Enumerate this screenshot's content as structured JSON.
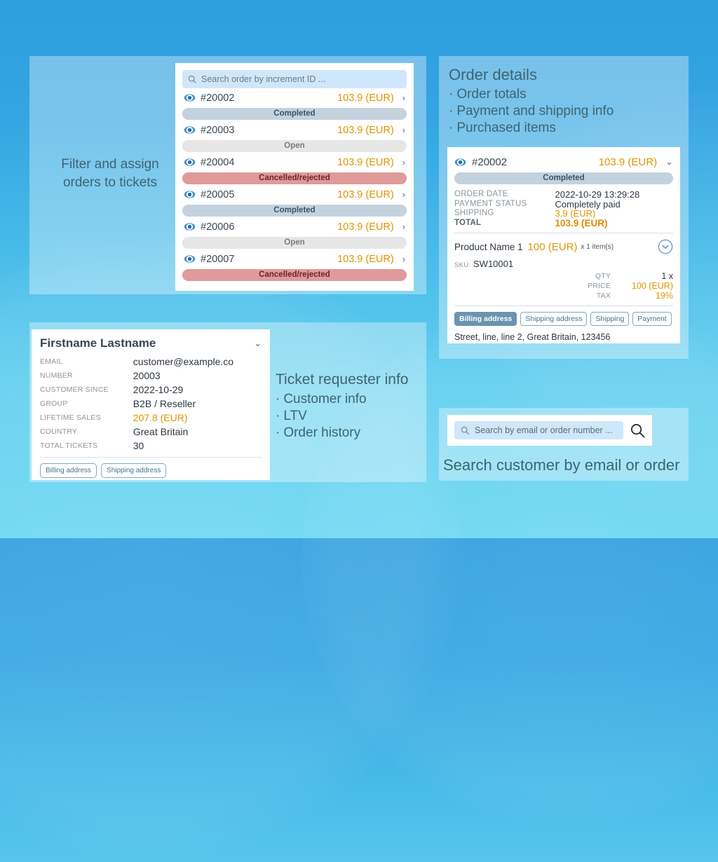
{
  "captions": {
    "filter_orders": "Filter and assign\norders to tickets",
    "order_details": {
      "title": "Order details",
      "bullets": [
        "Order totals",
        "Payment and shipping info",
        "Purchased items"
      ]
    },
    "requester": {
      "title": "Ticket requester info",
      "bullets": [
        "Customer info",
        "LTV",
        "Order history"
      ]
    },
    "search_customer": "Search customer by email or order"
  },
  "orders_panel": {
    "search": {
      "placeholder": "Search order by increment ID ...",
      "value": "",
      "icon": "search-icon"
    },
    "rows": [
      {
        "icon": "eye-icon",
        "id": "#20002",
        "amount": "103.9 (EUR)",
        "chevron": "›",
        "status": "Completed",
        "status_kind": "completed"
      },
      {
        "icon": "eye-icon",
        "id": "#20003",
        "amount": "103.9 (EUR)",
        "chevron": "›",
        "status": "Open",
        "status_kind": "open"
      },
      {
        "icon": "eye-icon",
        "id": "#20004",
        "amount": "103.9 (EUR)",
        "chevron": "›",
        "status": "Cancelled/rejected",
        "status_kind": "cancelled"
      },
      {
        "icon": "eye-icon",
        "id": "#20005",
        "amount": "103.9 (EUR)",
        "chevron": "›",
        "status": "Completed",
        "status_kind": "completed"
      },
      {
        "icon": "eye-icon",
        "id": "#20006",
        "amount": "103.9 (EUR)",
        "chevron": "›",
        "status": "Open",
        "status_kind": "open"
      },
      {
        "icon": "eye-icon",
        "id": "#20007",
        "amount": "103.9 (EUR)",
        "chevron": "›",
        "status": "Cancelled/rejected",
        "status_kind": "cancelled"
      }
    ]
  },
  "order_detail": {
    "header": {
      "id": "#20002",
      "amount": "103.9 (EUR)",
      "chevron": "⌄",
      "icon": "eye-icon"
    },
    "status": "Completed",
    "fields": [
      {
        "label": "ORDER DATE",
        "value": "2022-10-29 13:29:28",
        "amber": false,
        "bold": false
      },
      {
        "label": "PAYMENT STATUS",
        "value": "Completely paid",
        "amber": false,
        "bold": false
      },
      {
        "label": "SHIPPING",
        "value": "3.9 (EUR)",
        "amber": true,
        "bold": false
      },
      {
        "label": "TOTAL",
        "value": "103.9 (EUR)",
        "amber": true,
        "bold": true
      }
    ],
    "product": {
      "name": "Product Name 1",
      "price": "100 (EUR)",
      "qty_note": "x 1 item(s)",
      "expand_icon": "chevron-down-circle-icon",
      "sku_label": "SKU:",
      "sku_value": "SW10001",
      "rows": [
        {
          "label": "QTY",
          "value": "1 x",
          "amber": false
        },
        {
          "label": "PRICE",
          "value": "100 (EUR)",
          "amber": true
        },
        {
          "label": "TAX",
          "value": "19%",
          "amber": true
        }
      ]
    },
    "tabs": [
      {
        "label": "Billing address",
        "active": true
      },
      {
        "label": "Shipping address",
        "active": false
      },
      {
        "label": "Shipping",
        "active": false
      },
      {
        "label": "Payment",
        "active": false
      }
    ],
    "address": "Street, line, line 2, Great Britain, 123456"
  },
  "customer": {
    "name": "Firstname Lastname",
    "chevron": "⌄",
    "fields": [
      {
        "label": "EMAIL",
        "value": "customer@example.co",
        "amber": false
      },
      {
        "label": "NUMBER",
        "value": "20003",
        "amber": false
      },
      {
        "label": "CUSTOMER SINCE",
        "value": "2022-10-29",
        "amber": false
      },
      {
        "label": "GROUP",
        "value": "B2B / Reseller",
        "amber": false
      },
      {
        "label": "LIFETIME SALES",
        "value": "207.8 (EUR)",
        "amber": true
      },
      {
        "label": "COUNTRY",
        "value": "Great Britain",
        "amber": false
      },
      {
        "label": "TOTAL TICKETS",
        "value": "30",
        "amber": false
      }
    ],
    "tabs": [
      {
        "label": "Billing address",
        "active": false
      },
      {
        "label": "Shipping address",
        "active": false
      }
    ]
  },
  "customer_search": {
    "placeholder": "Search by email or order number ...",
    "value": "",
    "field_icon": "search-icon",
    "button_icon": "search-icon"
  },
  "colors": {
    "amber": "#e09400",
    "status_completed_bg": "#c3d2dd",
    "status_open_bg": "#e6e6e6",
    "status_cancelled_bg": "#e09a9a",
    "tab_active_bg": "#6a94b0",
    "caption_text": "#3d6470",
    "background_top": "#2e9ede",
    "background_bottom": "#6ad6f2"
  }
}
